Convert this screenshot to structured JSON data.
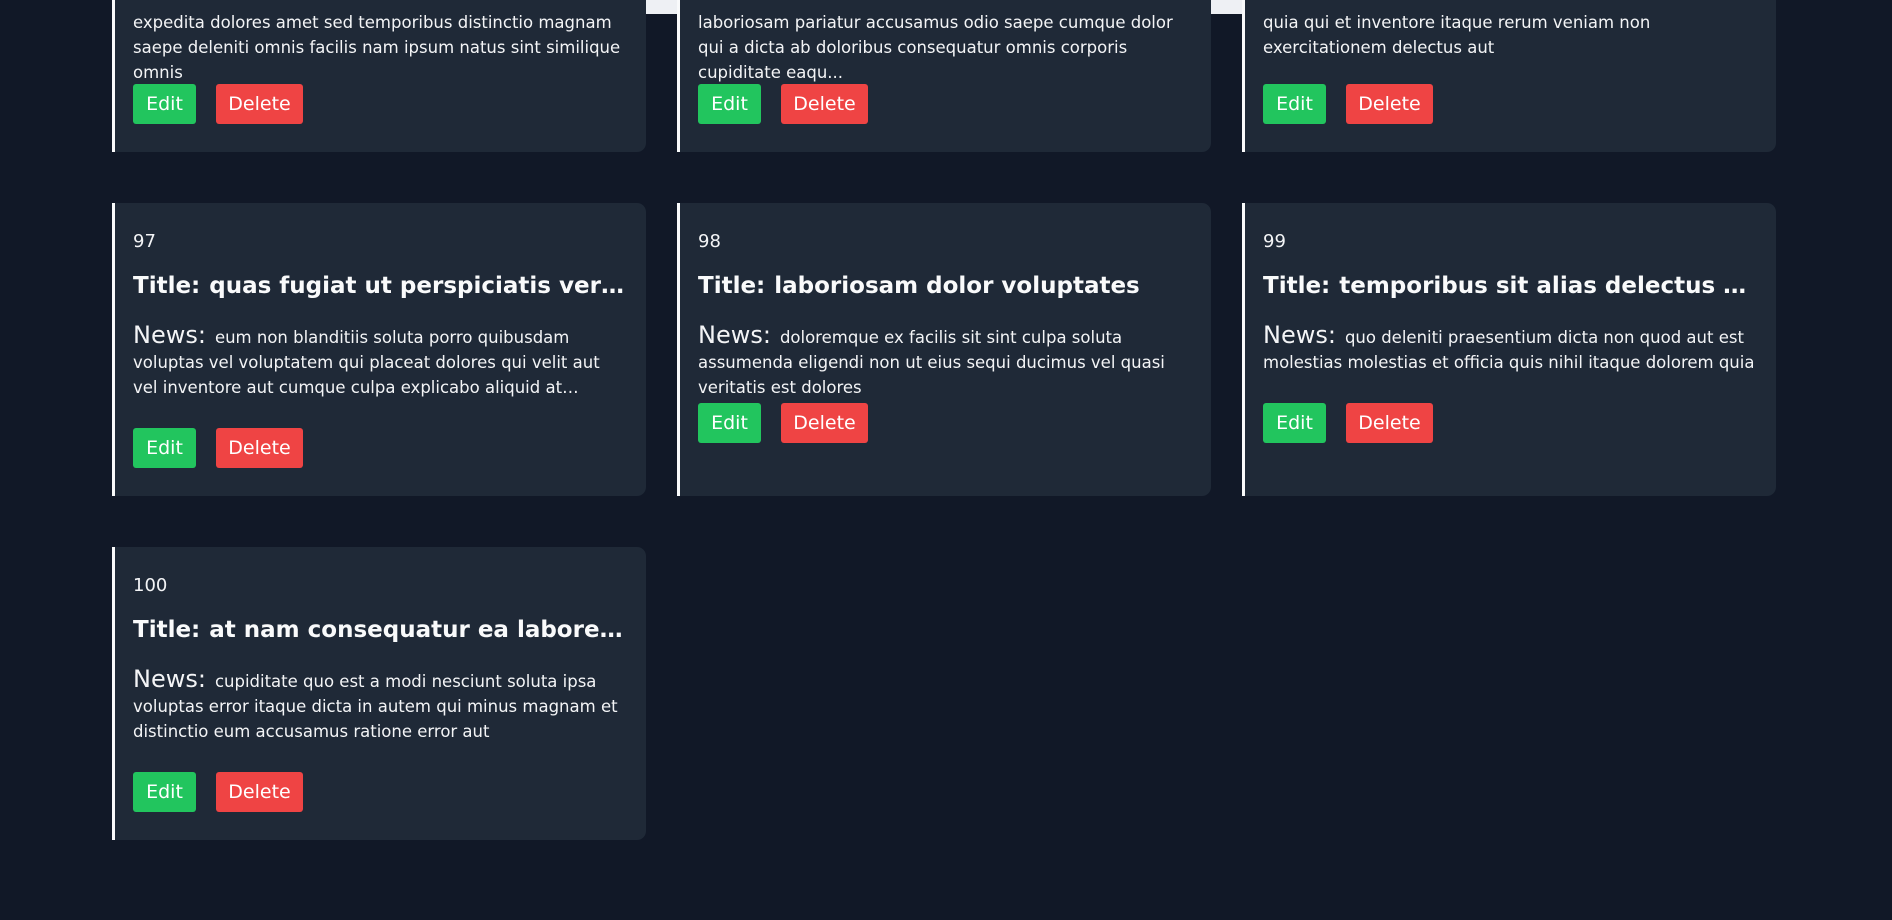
{
  "labels": {
    "title": "Title:",
    "news": "News:",
    "edit": "Edit",
    "delete": "Delete"
  },
  "top_cards": [
    {
      "news": "expedita dolores amet sed temporibus distinctio magnam saepe deleniti omnis facilis nam ipsum natus sint similique omnis"
    },
    {
      "news": "laboriosam pariatur accusamus odio saepe cumque dolor qui a dicta ab doloribus consequatur omnis corporis cupiditate eaqu..."
    },
    {
      "news": "quia qui et inventore itaque rerum veniam non exercitationem delectus aut"
    }
  ],
  "cards": [
    {
      "id": "97",
      "title": "quas fugiat ut perspiciatis vero...",
      "news": "eum non blanditiis soluta porro quibusdam voluptas vel voluptatem qui placeat dolores qui velit aut vel inventore aut cumque culpa explicabo aliquid at perspiciatis est et..."
    },
    {
      "id": "98",
      "title": "laboriosam dolor voluptates",
      "news": "doloremque ex facilis sit sint culpa soluta assumenda eligendi non ut eius sequi ducimus vel quasi veritatis est dolores"
    },
    {
      "id": "99",
      "title": "temporibus sit alias delectus eligendi...",
      "news": "quo deleniti praesentium dicta non quod aut est molestias molestias et officia quis nihil itaque dolorem quia"
    },
    {
      "id": "100",
      "title": "at nam consequatur ea labore ea...",
      "news": "cupiditate quo est a modi nesciunt soluta ipsa voluptas error itaque dicta in autem qui minus magnam et distinctio eum accusamus ratione error aut"
    }
  ],
  "colors": {
    "background": "#111827",
    "card": "#1f2937",
    "edit_button": "#22c55e",
    "delete_button": "#ef4444"
  }
}
